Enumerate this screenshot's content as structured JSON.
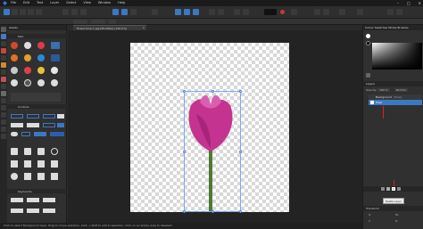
{
  "menu": {
    "items": [
      "File",
      "Edit",
      "Text",
      "Layer",
      "Select",
      "View",
      "Window",
      "Help"
    ],
    "window_controls": [
      "–",
      "□",
      "✕"
    ]
  },
  "document": {
    "tab_title": "flower-tulip-1.jpg [Modified] (100.0%)",
    "close_glyph": "×"
  },
  "left_panel": {
    "tabs_label": "Assets",
    "section_misc": "Misc",
    "section_controls": "Controls",
    "section_keyboards": "Keyboards"
  },
  "right_panel": {
    "tabs_label": "Colour  Swatches  Stroke  Brushes",
    "layers_tab": "Layers",
    "opacity_label": "Opacity:",
    "opacity_value": "100 %",
    "blend_label": "Normal",
    "layer_background": "Background",
    "layer_background_meta": "(Pixel)",
    "layer_selected": "Pixel",
    "tooltip": "Delete Layer",
    "transform_tab": "Transform",
    "transform_fields": [
      "X:",
      "Y:",
      "W:",
      "H:"
    ]
  },
  "status": {
    "text": "Click to select Background layer. Drag to move selection. Click + Shift to add to selection. Click on an empty area to deselect."
  },
  "colors": {
    "accent": "#3b78c4",
    "arrow": "#dd2222",
    "tulip": "#c4338f"
  }
}
